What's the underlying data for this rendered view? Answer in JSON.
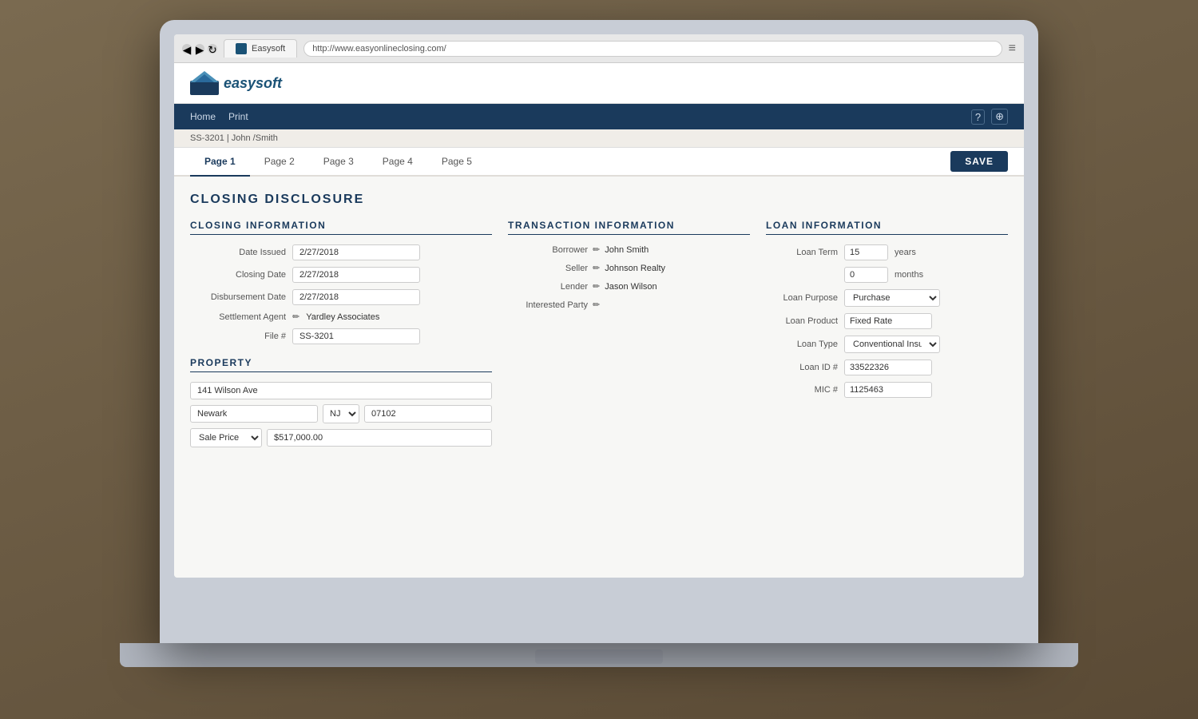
{
  "browser": {
    "tab_label": "Easysoft",
    "url": "http://www.easyonlineclosing.com/",
    "menu_icon": "≡"
  },
  "app": {
    "logo_text": "easysoft",
    "nav": {
      "links": [
        "Home",
        "Print"
      ],
      "icons": [
        "?",
        "⊕"
      ]
    },
    "breadcrumb": "SS-3201 | John /Smith",
    "tabs": [
      {
        "label": "Page 1",
        "active": true
      },
      {
        "label": "Page 2",
        "active": false
      },
      {
        "label": "Page 3",
        "active": false
      },
      {
        "label": "Page 4",
        "active": false
      },
      {
        "label": "Page 5",
        "active": false
      }
    ],
    "save_button": "SAVE",
    "page_title": "CLOSING DISCLOSURE",
    "closing_info": {
      "section_title": "CLOSING INFORMATION",
      "fields": [
        {
          "label": "Date Issued",
          "value": "2/27/2018"
        },
        {
          "label": "Closing Date",
          "value": "2/27/2018"
        },
        {
          "label": "Disbursement Date",
          "value": "2/27/2018"
        },
        {
          "label": "Settlement Agent",
          "value": "Yardley Associates",
          "has_edit": true
        },
        {
          "label": "File #",
          "value": "SS-3201"
        }
      ],
      "property_section_title": "PROPERTY",
      "property_address": "141 Wilson Ave",
      "property_city": "Newark",
      "property_state": "NJ",
      "property_zip": "07102",
      "sale_type": "Sale Price",
      "sale_amount": "$517,000.00"
    },
    "transaction_info": {
      "section_title": "TRANSACTION INFORMATION",
      "borrower_label": "Borrower",
      "borrower_value": "John Smith",
      "seller_label": "Seller",
      "seller_value": "Johnson Realty",
      "lender_label": "Lender",
      "lender_value": "Jason Wilson",
      "interested_party_label": "Interested Party"
    },
    "loan_info": {
      "section_title": "LOAN INFORMATION",
      "loan_term_label": "Loan Term",
      "loan_term_years": "15",
      "loan_term_years_unit": "years",
      "loan_term_months": "0",
      "loan_term_months_unit": "months",
      "loan_purpose_label": "Loan Purpose",
      "loan_purpose_value": "Purchase",
      "loan_product_label": "Loan Product",
      "loan_product_value": "Fixed Rate",
      "loan_type_label": "Loan Type",
      "loan_type_value": "Conventional Insured",
      "loan_id_label": "Loan ID #",
      "loan_id_value": "33522326",
      "mic_label": "MIC #",
      "mic_value": "1125463"
    }
  }
}
